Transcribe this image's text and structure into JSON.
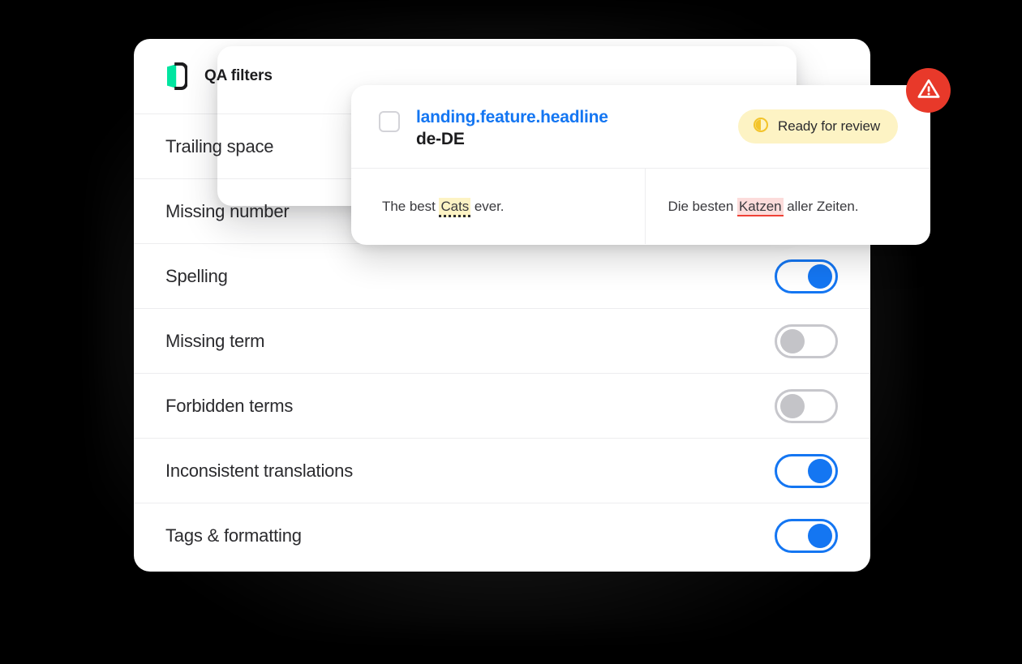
{
  "colors": {
    "background": "#000000",
    "panel": "#ffffff",
    "accent_blue": "#1476f2",
    "brand_green": "#00e5a0",
    "badge_yellow_bg": "#fdf3c4",
    "badge_yellow_icon": "#f3c42b",
    "error_red": "#e8392a",
    "source_highlight": "#fdf3c4",
    "target_highlight": "#fcdcdb",
    "target_underline": "#ef4136",
    "divider": "#ededef",
    "toggle_off": "#c7c7cc",
    "text_primary": "#2b2b2e"
  },
  "panel": {
    "header": {
      "logo_icon": "lokalise-book-logo",
      "title": "QA filters"
    },
    "filters": [
      {
        "label": "Trailing space",
        "toggle": "on",
        "toggle_visible": false
      },
      {
        "label": "Missing number",
        "toggle": "on",
        "toggle_visible": false
      },
      {
        "label": "Spelling",
        "toggle": "on",
        "toggle_visible": true
      },
      {
        "label": "Missing term",
        "toggle": "off",
        "toggle_visible": true
      },
      {
        "label": "Forbidden terms",
        "toggle": "off",
        "toggle_visible": true
      },
      {
        "label": "Inconsistent translations",
        "toggle": "on",
        "toggle_visible": true
      },
      {
        "label": "Tags & formatting",
        "toggle": "on",
        "toggle_visible": true
      }
    ]
  },
  "segment_card": {
    "checkbox_checked": false,
    "key": "landing.feature.headline",
    "locale": "de-DE",
    "status": {
      "icon": "half-circle-progress-icon",
      "label": "Ready for review"
    },
    "source": {
      "before": "The best ",
      "highlight": "Cats",
      "after": " ever."
    },
    "target": {
      "before": "Die besten ",
      "highlight": "Katzen",
      "after": " aller Zeiten."
    }
  },
  "error_badge": {
    "icon": "warning-triangle-icon"
  }
}
